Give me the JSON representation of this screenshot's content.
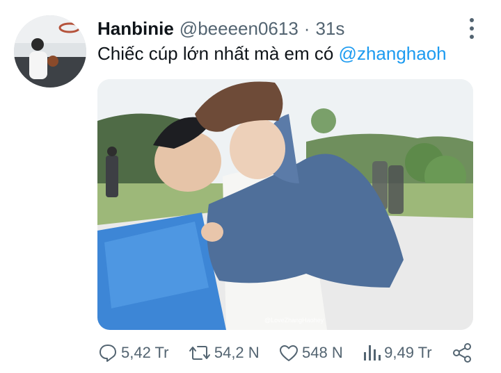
{
  "tweet": {
    "author_name": "Hanbinie",
    "author_handle": "@beeeen0613",
    "separator": "·",
    "time": "31s",
    "text": "Chiếc cúp lớn nhất mà em có ",
    "mention": "@zhanghaoh",
    "media_watermark": "@LoveZhangHaohey"
  },
  "actions": {
    "replies": "5,42 Tr",
    "retweets": "54,2 N",
    "likes": "548 N",
    "views": "9,49 Tr"
  },
  "icons": [
    "more-vertical-icon",
    "reply-icon",
    "retweet-icon",
    "like-icon",
    "views-icon",
    "share-icon"
  ],
  "colors": {
    "accent": "#1d9bf0",
    "muted": "#536471",
    "text": "#0f1419"
  }
}
